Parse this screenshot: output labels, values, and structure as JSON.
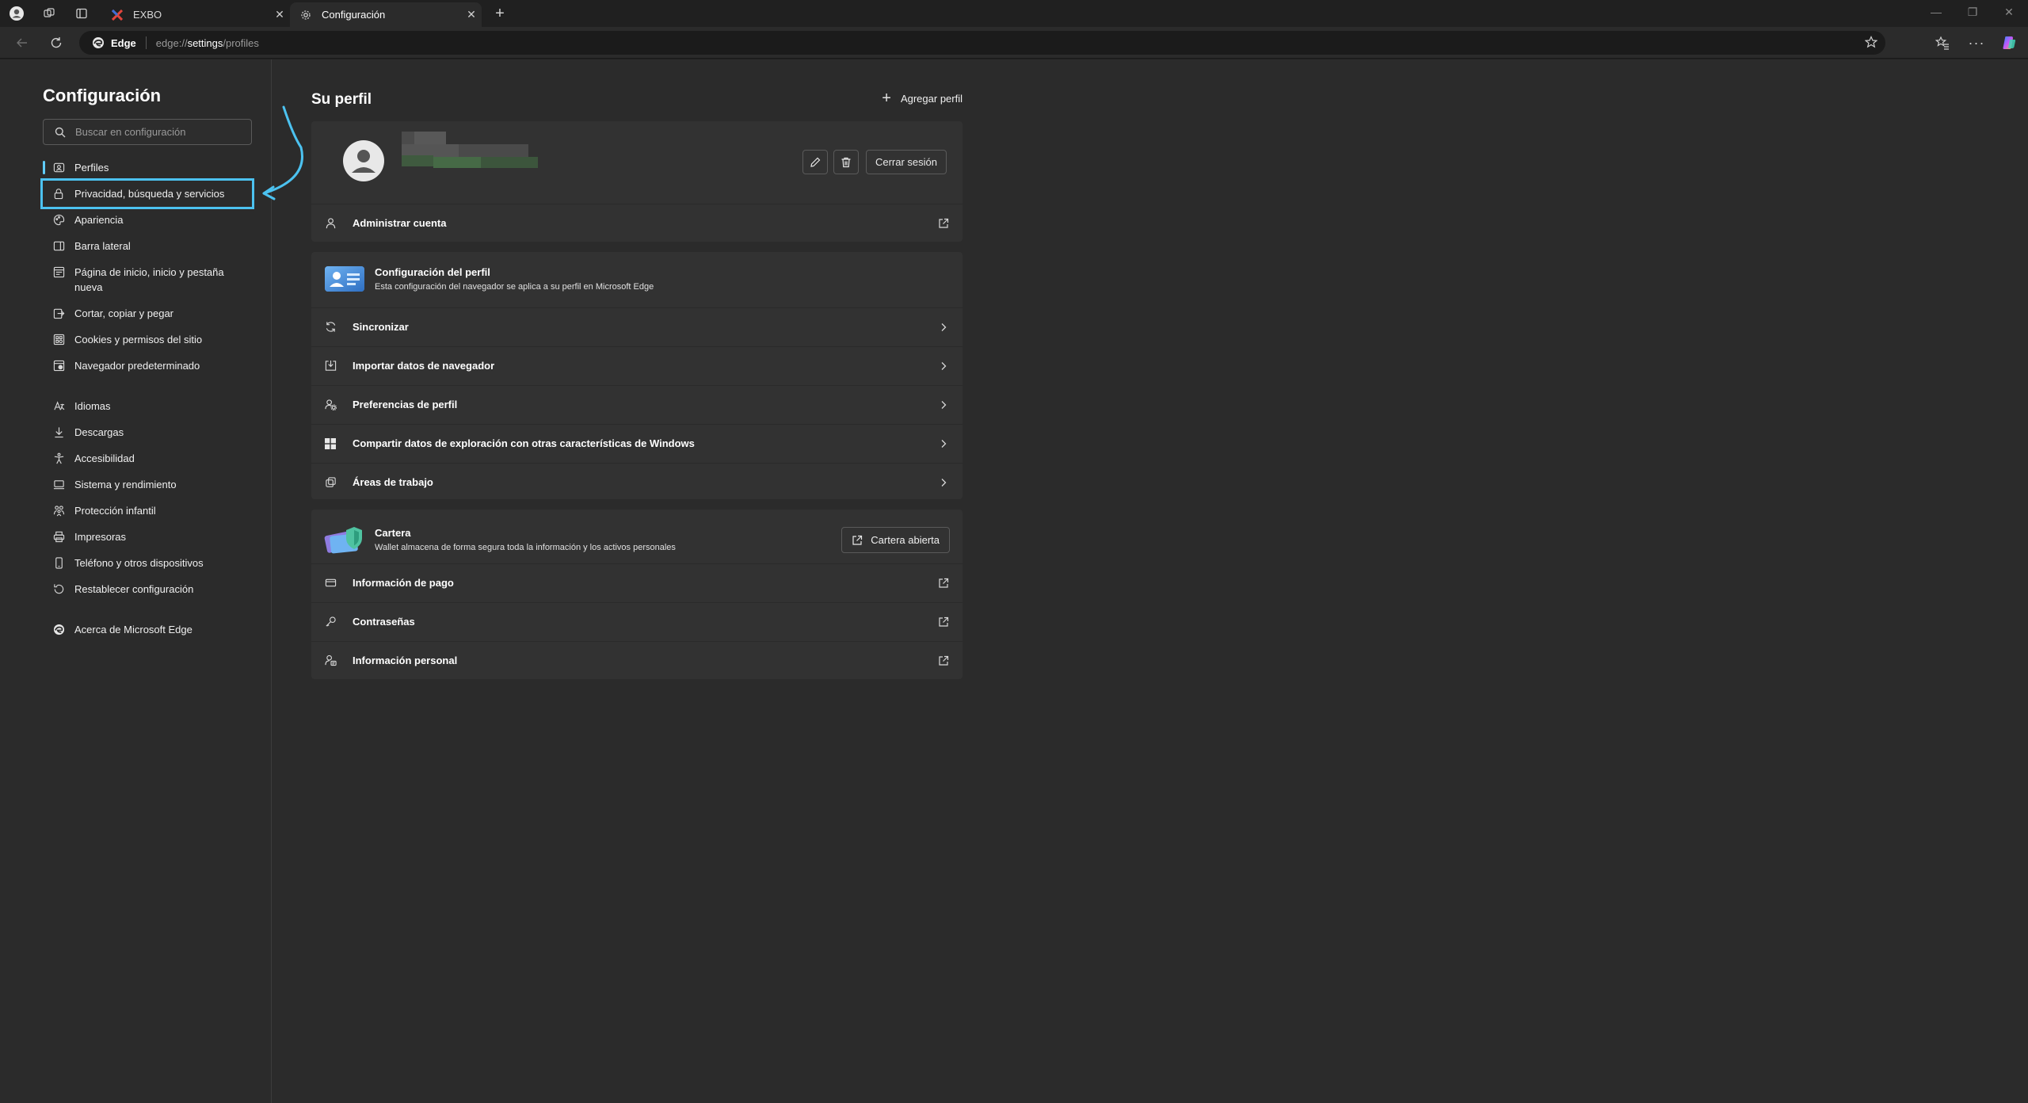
{
  "tabs": [
    {
      "title": "EXBO",
      "active": false
    },
    {
      "title": "Configuración",
      "active": true
    }
  ],
  "address": {
    "brand": "Edge",
    "url_prefix": "edge://",
    "url_host": "settings",
    "url_path": "/profiles"
  },
  "sidebar": {
    "title": "Configuración",
    "search_placeholder": "Buscar en configuración",
    "group1": [
      {
        "label": "Perfiles",
        "icon": "profiles-icon"
      },
      {
        "label": "Privacidad, búsqueda y servicios",
        "icon": "lock-icon"
      },
      {
        "label": "Apariencia",
        "icon": "appearance-icon"
      },
      {
        "label": "Barra lateral",
        "icon": "sidebar-icon"
      },
      {
        "label": "Página de inicio, inicio y pestaña nueva",
        "icon": "home-icon"
      },
      {
        "label": "Cortar, copiar y pegar",
        "icon": "clipboard-icon"
      },
      {
        "label": "Cookies y permisos del sitio",
        "icon": "cookies-icon"
      },
      {
        "label": "Navegador predeterminado",
        "icon": "browser-icon"
      }
    ],
    "group2": [
      {
        "label": "Idiomas",
        "icon": "languages-icon"
      },
      {
        "label": "Descargas",
        "icon": "download-icon"
      },
      {
        "label": "Accesibilidad",
        "icon": "accessibility-icon"
      },
      {
        "label": "Sistema y rendimiento",
        "icon": "system-icon"
      },
      {
        "label": "Protección infantil",
        "icon": "family-icon"
      },
      {
        "label": "Impresoras",
        "icon": "printer-icon"
      },
      {
        "label": "Teléfono y otros dispositivos",
        "icon": "phone-icon"
      },
      {
        "label": "Restablecer configuración",
        "icon": "reset-icon"
      }
    ],
    "group3": [
      {
        "label": "Acerca de Microsoft Edge",
        "icon": "edge-icon"
      }
    ]
  },
  "main": {
    "title": "Su perfil",
    "add_profile": "Agregar perfil",
    "sign_out": "Cerrar sesión",
    "manage_account": "Administrar cuenta",
    "profile_settings": {
      "title": "Configuración del perfil",
      "subtitle": "Esta configuración del navegador se aplica a su perfil en Microsoft Edge"
    },
    "profile_rows": [
      {
        "label": "Sincronizar",
        "icon": "sync-icon"
      },
      {
        "label": "Importar datos de navegador",
        "icon": "import-icon"
      },
      {
        "label": "Preferencias de perfil",
        "icon": "profile-prefs-icon"
      },
      {
        "label": "Compartir datos de exploración con otras características de Windows",
        "icon": "windows-icon"
      },
      {
        "label": "Áreas de trabajo",
        "icon": "workspaces-icon"
      }
    ],
    "wallet": {
      "title": "Cartera",
      "subtitle": "Wallet almacena de forma segura toda la información y los activos personales",
      "button": "Cartera abierta"
    },
    "wallet_rows": [
      {
        "label": "Información de pago",
        "icon": "card-icon"
      },
      {
        "label": "Contraseñas",
        "icon": "key-icon"
      },
      {
        "label": "Información personal",
        "icon": "personal-info-icon"
      }
    ]
  }
}
